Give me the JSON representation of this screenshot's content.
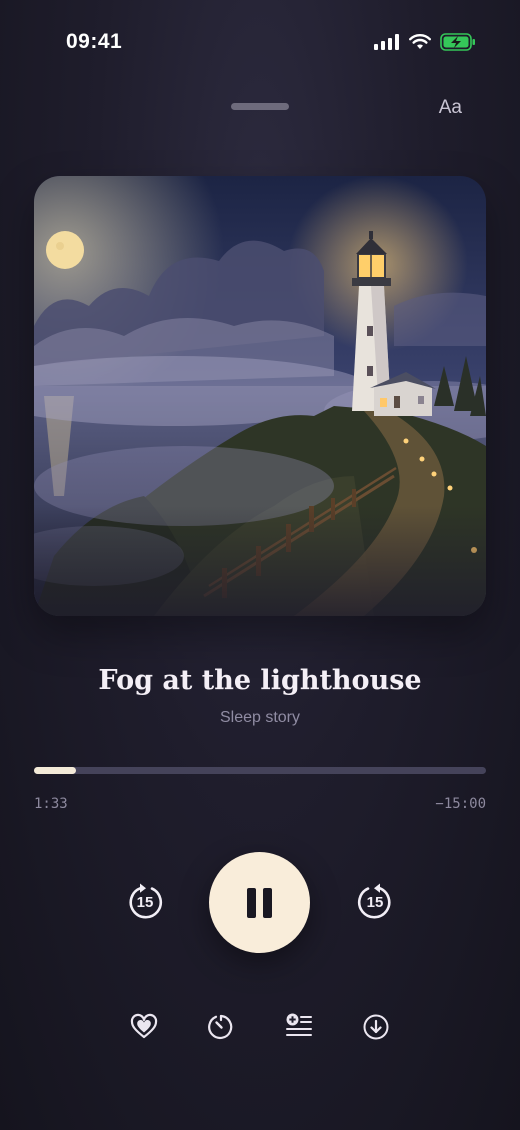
{
  "status_bar": {
    "time": "09:41",
    "icons": [
      "signal-icon",
      "wifi-icon",
      "battery-charging-icon"
    ],
    "battery_color": "#35c759"
  },
  "header": {
    "font_settings_label": "Aa"
  },
  "artwork": {
    "alt": "lighthouse-illustration"
  },
  "track": {
    "title": "Fog at the lighthouse",
    "subtitle": "Sleep story"
  },
  "progress": {
    "elapsed": "1:33",
    "remaining": "−15:00",
    "fraction": 0.094
  },
  "controls": {
    "skip_back_seconds": "15",
    "skip_forward_seconds": "15",
    "state": "playing",
    "play_button_color": "#f9edda"
  },
  "actions": [
    {
      "icon": "heart-icon"
    },
    {
      "icon": "sleep-timer-icon"
    },
    {
      "icon": "add-to-queue-icon"
    },
    {
      "icon": "download-icon"
    }
  ]
}
